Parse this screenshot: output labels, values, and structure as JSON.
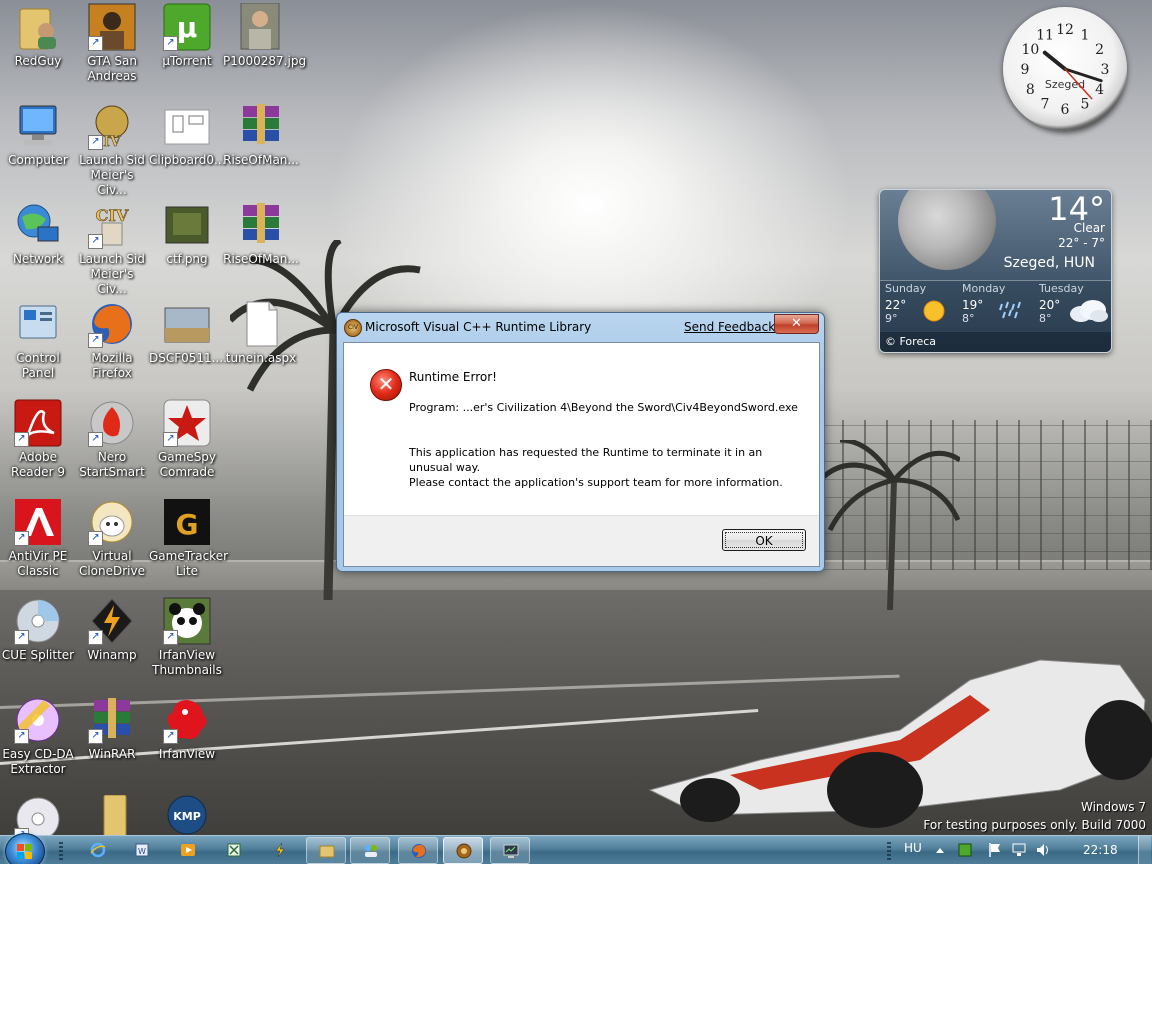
{
  "desktop": {
    "icons": [
      {
        "label": "RedGuy"
      },
      {
        "label": "GTA San Andreas"
      },
      {
        "label": "µTorrent"
      },
      {
        "label": "P1000287.jpg"
      },
      {
        "label": "Computer"
      },
      {
        "label": "Launch Sid Meier's Civ..."
      },
      {
        "label": "Clipboard0..."
      },
      {
        "label": "RiseOfMan..."
      },
      {
        "label": "Network"
      },
      {
        "label": "Launch Sid Meier's Civ..."
      },
      {
        "label": "ctf.png"
      },
      {
        "label": "RiseOfMan..."
      },
      {
        "label": "Control Panel"
      },
      {
        "label": "Mozilla Firefox"
      },
      {
        "label": "DSCF0511...."
      },
      {
        "label": "tunein.aspx"
      },
      {
        "label": "Adobe Reader 9"
      },
      {
        "label": "Nero StartSmart"
      },
      {
        "label": "GameSpy Comrade"
      },
      {
        "label": "AntiVir PE Classic"
      },
      {
        "label": "Virtual CloneDrive"
      },
      {
        "label": "GameTracker Lite"
      },
      {
        "label": "CUE Splitter"
      },
      {
        "label": "Winamp"
      },
      {
        "label": "IrfanView Thumbnails"
      },
      {
        "label": "Easy CD-DA Extractor"
      },
      {
        "label": "WinRAR"
      },
      {
        "label": "IrfanView"
      },
      {
        "label": ""
      },
      {
        "label": ""
      },
      {
        "label": ""
      }
    ],
    "watermark": {
      "line1": "Windows  7",
      "line2": "For testing purposes only. Build 7000"
    }
  },
  "clock_gadget": {
    "city": "Szeged",
    "numbers": [
      "12",
      "1",
      "2",
      "3",
      "4",
      "5",
      "6",
      "7",
      "8",
      "9",
      "10",
      "11"
    ],
    "time": "22:18"
  },
  "weather_gadget": {
    "temperature": "14°",
    "condition": "Clear",
    "range": "22°  -  7°",
    "location": "Szeged, HUN",
    "forecast": [
      {
        "day": "Sunday",
        "high": "22°",
        "low": "9°",
        "icon": "sun-icon"
      },
      {
        "day": "Monday",
        "high": "19°",
        "low": "8°",
        "icon": "rain-icon"
      },
      {
        "day": "Tuesday",
        "high": "20°",
        "low": "8°",
        "icon": "cloud-icon"
      }
    ],
    "footer": "© Foreca"
  },
  "dialog": {
    "title": "Microsoft Visual C++ Runtime Library",
    "app_icon_text": "CIV",
    "feedback_link": "Send Feedback",
    "close_glyph": "✕",
    "error_title": "Runtime Error!",
    "program_line": "Program: ...er's Civilization 4\\Beyond the Sword\\Civ4BeyondSword.exe",
    "message_line1": "This application has requested the Runtime to terminate it in an",
    "message_line2": "unusual way.",
    "message_line3": "Please contact the application's support team for more information.",
    "ok_label": "OK"
  },
  "taskbar": {
    "language": "HU",
    "clock": "22:18",
    "colors": {
      "accent": "#4f7d98",
      "dialog_frame": "#a6c6e6",
      "error_red": "#e02a18"
    }
  }
}
